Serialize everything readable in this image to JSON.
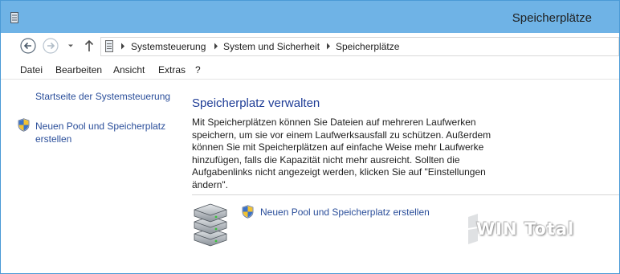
{
  "window": {
    "title": "Speicherplätze"
  },
  "navigation": {
    "back_icon": "back-arrow-icon",
    "forward_icon": "forward-arrow-icon",
    "recent_icon": "chevron-down-icon",
    "up_icon": "up-arrow-icon"
  },
  "address": {
    "breadcrumbs": [
      "Systemsteuerung",
      "System und Sicherheit",
      "Speicherplätze"
    ]
  },
  "menu": {
    "items": [
      "Datei",
      "Bearbeiten",
      "Ansicht",
      "Extras",
      "?"
    ]
  },
  "sidebar": {
    "home_link": "Startseite der Systemsteuerung",
    "create_link": "Neuen Pool und Speicherplatz erstellen"
  },
  "main": {
    "heading": "Speicherplatz verwalten",
    "description": "Mit Speicherplätzen können Sie Dateien auf mehreren Laufwerken speichern, um sie vor einem Laufwerksausfall zu schützen. Außerdem können Sie mit Speicherplätzen auf einfache Weise mehr Laufwerke hinzufügen, falls die Kapazität nicht mehr ausreicht. Sollten die Aufgabenlinks nicht angezeigt werden, klicken Sie auf \"Einstellungen ändern\".",
    "task_link": "Neuen Pool und Speicherplatz erstellen"
  },
  "watermark": {
    "text": "WIN Total"
  },
  "colors": {
    "titlebar": "#6fb3e6",
    "link": "#2a4e9a",
    "heading": "#1e3c96"
  }
}
